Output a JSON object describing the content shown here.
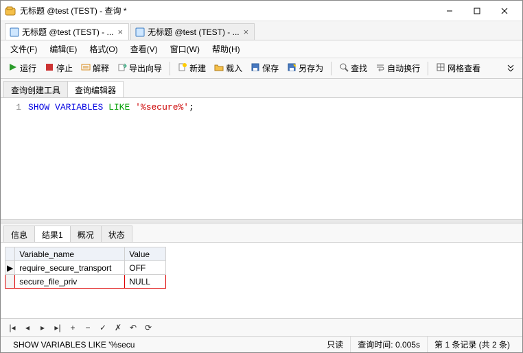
{
  "window": {
    "title": "无标题 @test (TEST) - 查询 *"
  },
  "doc_tabs": [
    {
      "label": "无标题 @test (TEST) - ...",
      "active": true
    },
    {
      "label": "无标题 @test (TEST) - ...",
      "active": false
    }
  ],
  "menu": {
    "file": "文件(F)",
    "edit": "编辑(E)",
    "format": "格式(O)",
    "view": "查看(V)",
    "window": "窗口(W)",
    "help": "帮助(H)"
  },
  "toolbar": {
    "run": "运行",
    "stop": "停止",
    "explain": "解释",
    "export_wizard": "导出向导",
    "new": "新建",
    "load": "载入",
    "save": "保存",
    "save_as": "另存为",
    "find": "查找",
    "word_wrap": "自动换行",
    "grid_view": "网格查看"
  },
  "editor_tabs": {
    "builder": "查询创建工具",
    "editor": "查询编辑器"
  },
  "code": {
    "line_no": "1",
    "kw1": "SHOW",
    "kw2": "VARIABLES",
    "kw3": "LIKE",
    "str": "'%secure%'",
    "semi": ";"
  },
  "result_tabs": {
    "info": "信息",
    "result1": "结果1",
    "summary": "概况",
    "status": "状态"
  },
  "result_table": {
    "headers": [
      "Variable_name",
      "Value"
    ],
    "rows": [
      {
        "current": true,
        "cells": [
          "require_secure_transport",
          "OFF"
        ]
      },
      {
        "current": false,
        "selected": true,
        "cells": [
          "secure_file_priv",
          "NULL"
        ]
      }
    ]
  },
  "status": {
    "sql": "SHOW VARIABLES LIKE '%secu",
    "readonly": "只读",
    "time": "查询时间: 0.005s",
    "records": "第 1 条记录 (共 2 条)"
  }
}
